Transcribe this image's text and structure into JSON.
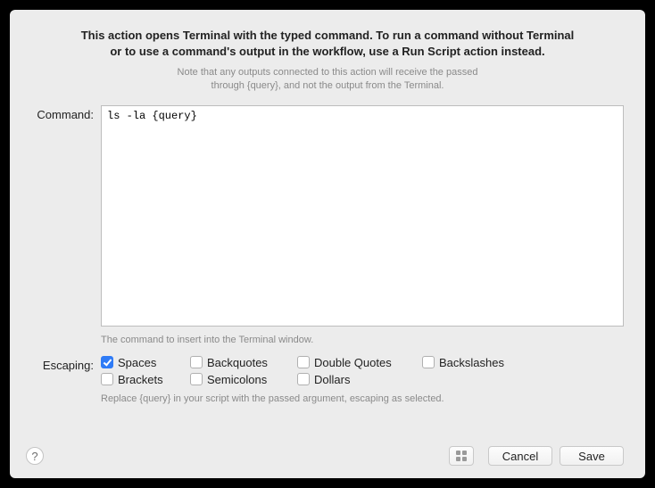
{
  "header": {
    "line1": "This action opens Terminal with the typed command. To run a command without Terminal",
    "line2": "or to use a command's output in the workflow, use a Run Script action instead.",
    "note1": "Note that any outputs connected to this action will receive the passed",
    "note2": "through {query}, and not the output from the Terminal."
  },
  "labels": {
    "command": "Command:",
    "escaping": "Escaping:"
  },
  "command": {
    "value": "ls -la {query}",
    "hint": "The command to insert into the Terminal window."
  },
  "escaping": {
    "options": [
      {
        "key": "spaces",
        "label": "Spaces",
        "checked": true
      },
      {
        "key": "backquotes",
        "label": "Backquotes",
        "checked": false
      },
      {
        "key": "double_quotes",
        "label": "Double Quotes",
        "checked": false
      },
      {
        "key": "backslashes",
        "label": "Backslashes",
        "checked": false
      },
      {
        "key": "brackets",
        "label": "Brackets",
        "checked": false
      },
      {
        "key": "semicolons",
        "label": "Semicolons",
        "checked": false
      },
      {
        "key": "dollars",
        "label": "Dollars",
        "checked": false
      }
    ],
    "hint": "Replace {query} in your script with the passed argument, escaping as selected."
  },
  "footer": {
    "help": "?",
    "cancel": "Cancel",
    "save": "Save"
  }
}
